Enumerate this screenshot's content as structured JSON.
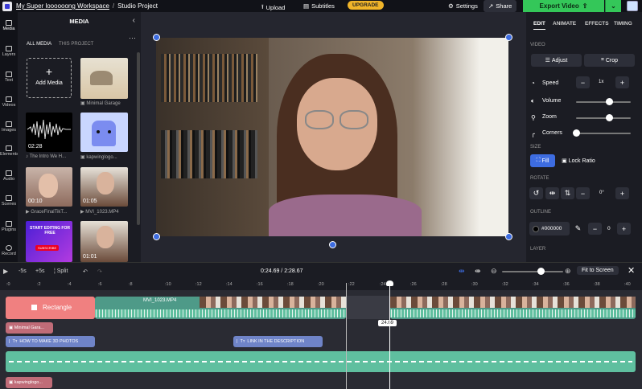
{
  "topbar": {
    "workspace": "My Super loooooong Workspace",
    "project": "Studio Project",
    "upload": "Upload",
    "subtitles": "Subtitles",
    "upgrade": "UPGRADE",
    "settings": "Settings",
    "share": "Share",
    "export": "Export Video"
  },
  "rail": [
    {
      "label": "Media"
    },
    {
      "label": "Layers"
    },
    {
      "label": "Text"
    },
    {
      "label": "Videos"
    },
    {
      "label": "Images"
    },
    {
      "label": "Elements"
    },
    {
      "label": "Audio"
    },
    {
      "label": "Scenes"
    },
    {
      "label": "Plugins"
    },
    {
      "label": "Record"
    }
  ],
  "media": {
    "title": "MEDIA",
    "tab_all": "ALL MEDIA",
    "tab_project": "THIS PROJECT",
    "add_media": "Add Media",
    "items": [
      {
        "label": "Minimal Garage",
        "duration": ""
      },
      {
        "label": "The Intro We H...",
        "duration": "02:28"
      },
      {
        "label": "kapwinglogo...",
        "duration": ""
      },
      {
        "label": "GraceFinalTikT...",
        "duration": "00:10"
      },
      {
        "label": "MVI_1023.MP4",
        "duration": "01:05"
      },
      {
        "label": "START EDITING FOR FREE",
        "duration": ""
      },
      {
        "label": "",
        "duration": "01:01"
      }
    ],
    "subscribe": "SUBSCRIBE"
  },
  "right": {
    "tabs": [
      "EDIT",
      "ANIMATE",
      "EFFECTS",
      "TIMING"
    ],
    "section_video": "VIDEO",
    "adjust": "Adjust",
    "crop": "Crop",
    "speed": "Speed",
    "speed_value": "1x",
    "volume": "Volume",
    "volume_level": 0.6,
    "zoom": "Zoom",
    "zoom_level": 0.6,
    "corners": "Corners",
    "corners_level": 0.0,
    "section_size": "SIZE",
    "fill": "Fill",
    "lock_ratio": "Lock Ratio",
    "section_rotate": "ROTATE",
    "rotate_value": "0°",
    "section_outline": "OUTLINE",
    "outline_color": "#000000",
    "outline_value": "0",
    "section_layer": "LAYER"
  },
  "timeline": {
    "back5": "-5s",
    "fwd5": "+5s",
    "split": "Split",
    "time": "0:24.69 / 2:28.67",
    "fit": "Fit to Screen",
    "ticks": [
      ":0",
      ":2",
      ":4",
      ":6",
      ":8",
      ":10",
      ":12",
      ":14",
      ":16",
      ":18",
      ":20",
      ":22",
      ":24",
      ":26",
      ":28",
      ":30",
      ":32",
      ":34",
      ":36",
      ":38",
      ":40"
    ],
    "playhead_label": "24.69",
    "clips": {
      "rectangle": "Rectangle",
      "video": "MVI_1023.MP4",
      "minimal": "Minimal Gara...",
      "text1": "HOW TO MAKE 3D PHOTOS",
      "text2": "LINK IN THE DESCRIPTION",
      "kapwing": "kapwinglogo..."
    }
  },
  "colors": {
    "accent_blue": "#3d6ce0",
    "export_green": "#34c759",
    "upgrade_yellow": "#f0b429",
    "rect_pink": "#f08080",
    "audio_teal": "#5fbf9f",
    "text_blue": "#6f84c8"
  }
}
